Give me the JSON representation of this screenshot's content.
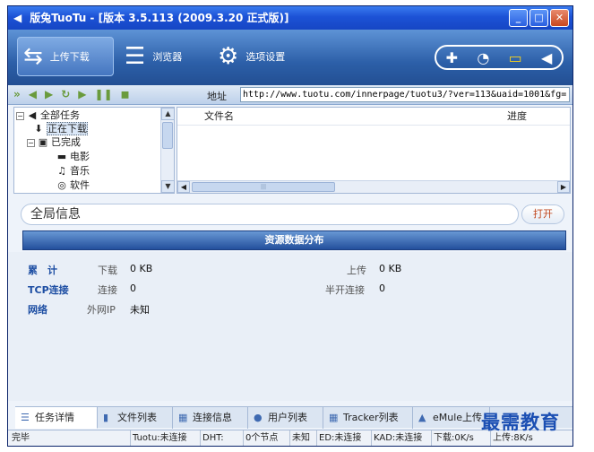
{
  "window": {
    "title": "版兔TuoTu - [版本 3.5.113 (2009.3.20 正式版)]"
  },
  "toolbar": {
    "upload_label": "上传下载",
    "browser_label": "浏览器",
    "settings_label": "选项设置"
  },
  "navbar": {
    "address_label": "地址",
    "address_value": "http://www.tuotu.com/innerpage/tuotu3/?ver=113&uaid=1001&fg="
  },
  "tree": {
    "items": [
      {
        "label": "全部任务"
      },
      {
        "label": "正在下载"
      },
      {
        "label": "已完成"
      },
      {
        "label": "电影"
      },
      {
        "label": "音乐"
      },
      {
        "label": "软件"
      }
    ]
  },
  "list": {
    "columns": [
      "文件名",
      "进度"
    ]
  },
  "info": {
    "title": "全局信息",
    "open_button": "打开",
    "section_header": "资源数据分布"
  },
  "stats": {
    "total_label": "累　计",
    "download_label": "下载",
    "download_value": "0 KB",
    "upload_label": "上传",
    "upload_value": "0 KB",
    "tcp_label": "TCP连接",
    "connect_label": "连接",
    "connect_value": "0",
    "halfopen_label": "半开连接",
    "halfopen_value": "0",
    "network_label": "网络",
    "wanip_label": "外网IP",
    "wanip_value": "未知"
  },
  "tabs": [
    {
      "label": "任务详情"
    },
    {
      "label": "文件列表"
    },
    {
      "label": "连接信息"
    },
    {
      "label": "用户列表"
    },
    {
      "label": "Tracker列表"
    },
    {
      "label": "eMule上传"
    }
  ],
  "statusbar": {
    "status": "完毕",
    "tuotu": "Tuotu:未连接",
    "dht_label": "DHT:",
    "nodes": "0个节点",
    "unknown": "未知",
    "ed": "ED:未连接",
    "kad": "KAD:未连接",
    "down": "下载:0K/s",
    "up": "上传:8K/s"
  },
  "watermark": "最需教育"
}
